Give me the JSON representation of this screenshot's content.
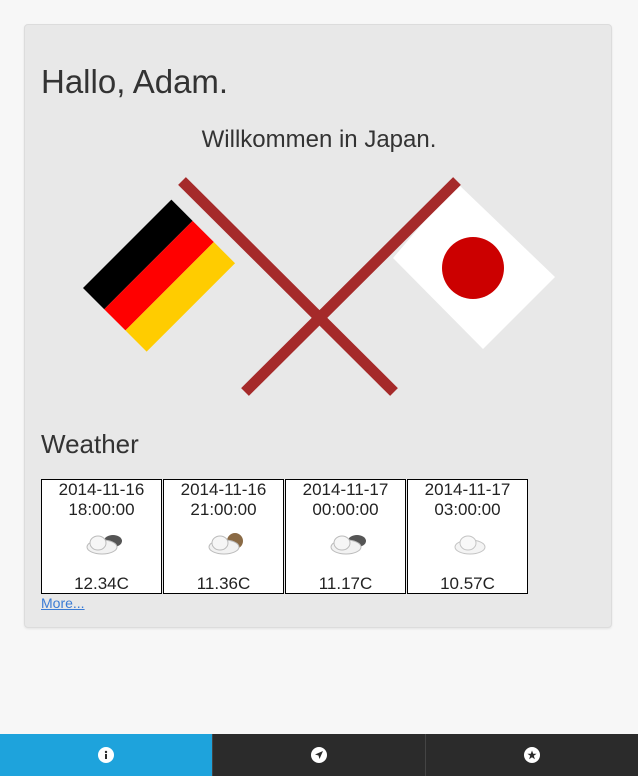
{
  "greeting": "Hallo, Adam.",
  "welcome": "Willkommen in Japan.",
  "weather": {
    "heading": "Weather",
    "more_label": "More...",
    "forecasts": [
      {
        "date": "2014-11-16",
        "time": "18:00:00",
        "icon": "cloud-moon-icon",
        "temp": "12.34C"
      },
      {
        "date": "2014-11-16",
        "time": "21:00:00",
        "icon": "cloud-moon-icon",
        "temp": "11.36C"
      },
      {
        "date": "2014-11-17",
        "time": "00:00:00",
        "icon": "cloud-moon-icon",
        "temp": "11.17C"
      },
      {
        "date": "2014-11-17",
        "time": "03:00:00",
        "icon": "cloud-icon",
        "temp": "10.57C"
      }
    ]
  },
  "tabs": [
    {
      "icon": "info-icon",
      "active": true
    },
    {
      "icon": "location-arrow-icon",
      "active": false
    },
    {
      "icon": "star-icon",
      "active": false
    }
  ],
  "colors": {
    "accent": "#1ea3dc",
    "tabbar": "#2b2b2b",
    "flag_pole": "#a52a2a",
    "de_black": "#000000",
    "de_red": "#ff0000",
    "de_gold": "#ffcc00",
    "jp_red": "#cc0000"
  }
}
